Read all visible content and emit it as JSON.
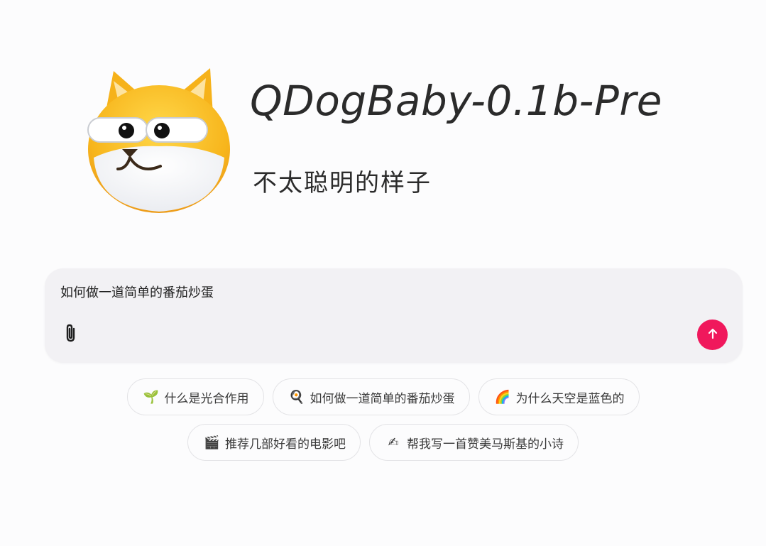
{
  "app": {
    "title": "QDogBaby-0.1b-Pre",
    "subtitle": "不太聪明的样子"
  },
  "composer": {
    "input_value": "如何做一道简单的番茄炒蛋",
    "attach_icon": "paperclip-icon",
    "send_icon": "arrow-up-icon",
    "accent_color": "#f0185c"
  },
  "suggestions": [
    [
      {
        "icon": "🌱",
        "icon_name": "seedling-icon",
        "label": "什么是光合作用"
      },
      {
        "icon": "🍳",
        "icon_name": "frying-pan-icon",
        "label": "如何做一道简单的番茄炒蛋"
      },
      {
        "icon": "🌈",
        "icon_name": "rainbow-icon",
        "label": "为什么天空是蓝色的"
      }
    ],
    [
      {
        "icon": "🎬",
        "icon_name": "clapper-board-icon",
        "label": "推荐几部好看的电影吧"
      },
      {
        "icon": "✍",
        "icon_name": "writing-hand-icon",
        "label": "帮我写一首赞美马斯基的小诗"
      }
    ]
  ]
}
